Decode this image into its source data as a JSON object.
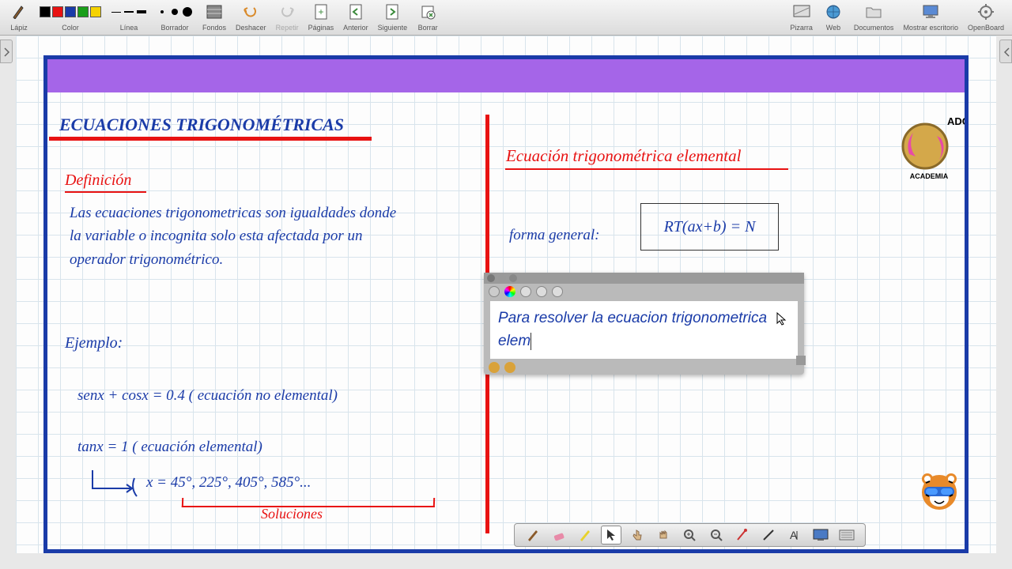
{
  "toolbar": {
    "lapiz": "Lápiz",
    "color": "Color",
    "linea": "Línea",
    "borrador": "Borrador",
    "fondos": "Fondos",
    "deshacer": "Deshacer",
    "repetir": "Repetir",
    "paginas": "Páginas",
    "anterior": "Anterior",
    "siguiente": "Siguiente",
    "borrar": "Borrar",
    "pizarra": "Pizarra",
    "web": "Web",
    "documentos": "Documentos",
    "mostrar_escritorio": "Mostrar escritorio",
    "openboard": "OpenBoard",
    "colors": [
      "#000000",
      "#e81212",
      "#1a3ba8",
      "#1a9e1a",
      "#f5d200"
    ]
  },
  "page": {
    "title": "ECUACIONES TRIGONOMÉTRICAS",
    "def_label": "Definición",
    "def_text": "Las ecuaciones trigonometricas son igualdades donde la variable o incognita solo esta afectada por un operador trigonométrico.",
    "ejemplo_label": "Ejemplo:",
    "eq1": "senx + cosx = 0.4   ( ecuación no elemental)",
    "eq2": "tanx = 1   ( ecuación  elemental)",
    "sol_values": "x = 45°, 225°, 405°, 585°...",
    "sol_label": "Soluciones",
    "right_title": "Ecuación trigonométrica elemental",
    "forma_label": "forma general:",
    "forma_eq": "RT(ax+b) = N",
    "logo_text_top": "ADC",
    "logo_text_bottom": "ACADEMIA"
  },
  "text_editor": {
    "content": "Para resolver la ecuacion trigonometrica elem"
  },
  "dock": {
    "tools": [
      "pen",
      "eraser",
      "highlighter",
      "pointer",
      "hand-point",
      "hand-grab",
      "zoom-in",
      "zoom-out",
      "laser",
      "line",
      "text",
      "capture",
      "keyboard"
    ]
  }
}
